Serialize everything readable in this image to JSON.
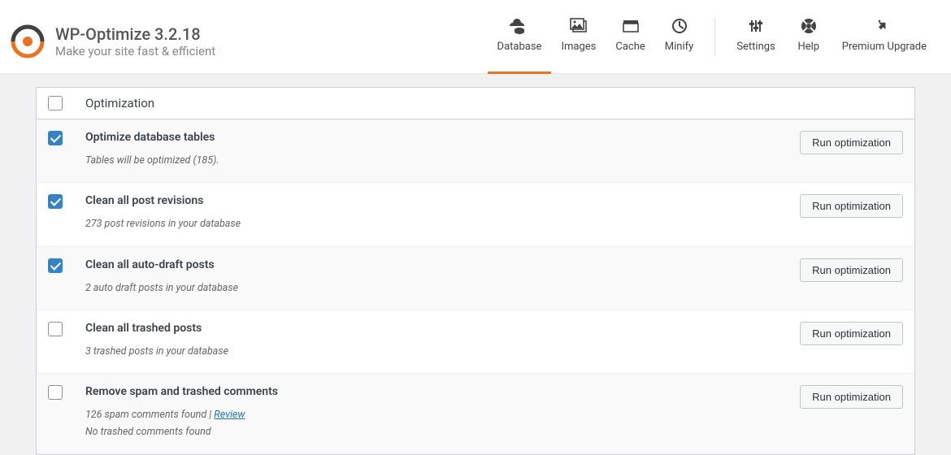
{
  "brand": {
    "title": "WP-Optimize 3.2.18",
    "tagline": "Make your site fast & efficient"
  },
  "nav": {
    "left": [
      {
        "key": "database",
        "label": "Database",
        "active": true
      },
      {
        "key": "images",
        "label": "Images",
        "active": false
      },
      {
        "key": "cache",
        "label": "Cache",
        "active": false
      },
      {
        "key": "minify",
        "label": "Minify",
        "active": false
      }
    ],
    "right": [
      {
        "key": "settings",
        "label": "Settings"
      },
      {
        "key": "help",
        "label": "Help"
      },
      {
        "key": "premium",
        "label": "Premium Upgrade"
      }
    ]
  },
  "panel": {
    "header": "Optimization",
    "button_label": "Run optimization",
    "rows": [
      {
        "checked": true,
        "title": "Optimize database tables",
        "subs": [
          "Tables will be optimized (185)."
        ],
        "link": null
      },
      {
        "checked": true,
        "title": "Clean all post revisions",
        "subs": [
          "273 post revisions in your database"
        ],
        "link": null
      },
      {
        "checked": true,
        "title": "Clean all auto-draft posts",
        "subs": [
          "2 auto draft posts in your database"
        ],
        "link": null
      },
      {
        "checked": false,
        "title": "Clean all trashed posts",
        "subs": [
          "3 trashed posts in your database"
        ],
        "link": null
      },
      {
        "checked": false,
        "title": "Remove spam and trashed comments",
        "subs": [
          "126 spam comments found | ",
          "No trashed comments found"
        ],
        "link": "Review"
      }
    ]
  }
}
